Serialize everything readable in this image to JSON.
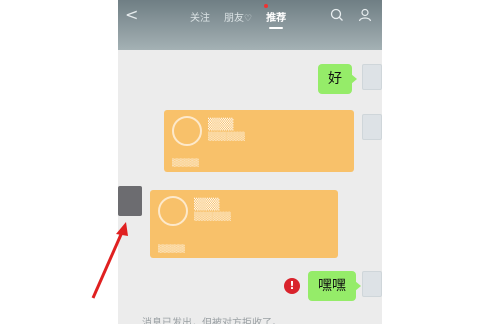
{
  "header": {
    "back_label": "<",
    "tabs": [
      {
        "label": "关注"
      },
      {
        "label": "朋友"
      },
      {
        "label": "推荐"
      }
    ]
  },
  "chat": {
    "messages": [
      {
        "text": "好"
      },
      {
        "text": "嘿嘿"
      }
    ],
    "system_message": "消息已发出，但被对方拒收了。"
  },
  "annotation": {
    "arrow_color": "#e02020"
  },
  "colors": {
    "bubble": "#95ec69",
    "card": "#f8c16a",
    "error": "#d9232c"
  }
}
